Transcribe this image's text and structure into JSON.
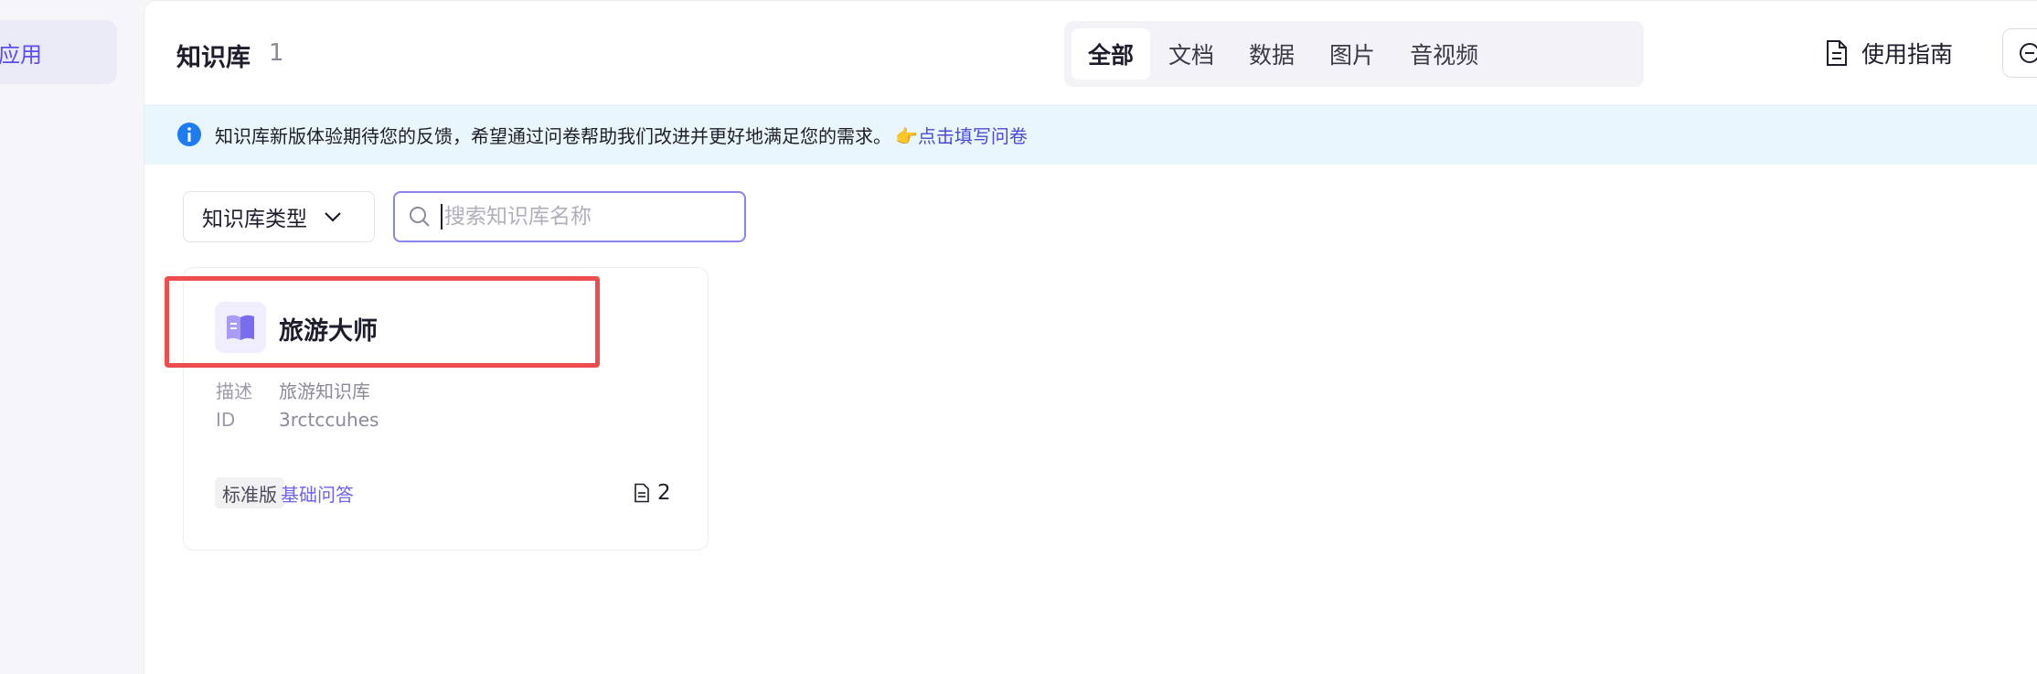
{
  "sidebar": {
    "active_item": "应用"
  },
  "header": {
    "title": "知识库",
    "count": "1",
    "tabs": [
      {
        "label": "全部",
        "active": true
      },
      {
        "label": "文档",
        "active": false
      },
      {
        "label": "数据",
        "active": false
      },
      {
        "label": "图片",
        "active": false
      },
      {
        "label": "音视频",
        "active": false
      }
    ],
    "guide_label": "使用指南"
  },
  "notice": {
    "text": "知识库新版体验期待您的反馈，希望通过问卷帮助我们改进并更好地满足您的需求。",
    "link": "👉点击填写问卷"
  },
  "filter": {
    "label": "知识库类型"
  },
  "search": {
    "placeholder": "搜索知识库名称"
  },
  "card": {
    "title": "旅游大师",
    "desc_label": "描述",
    "desc_value": "旅游知识库",
    "id_label": "ID",
    "id_value": "3rctccuhes",
    "tag_edition": "标准版",
    "tag_type": "基础问答",
    "doc_count": "2"
  },
  "colors": {
    "accent": "#5b4ff0",
    "notice_bg": "#eaf6fd",
    "highlight": "#ee4d4d"
  }
}
